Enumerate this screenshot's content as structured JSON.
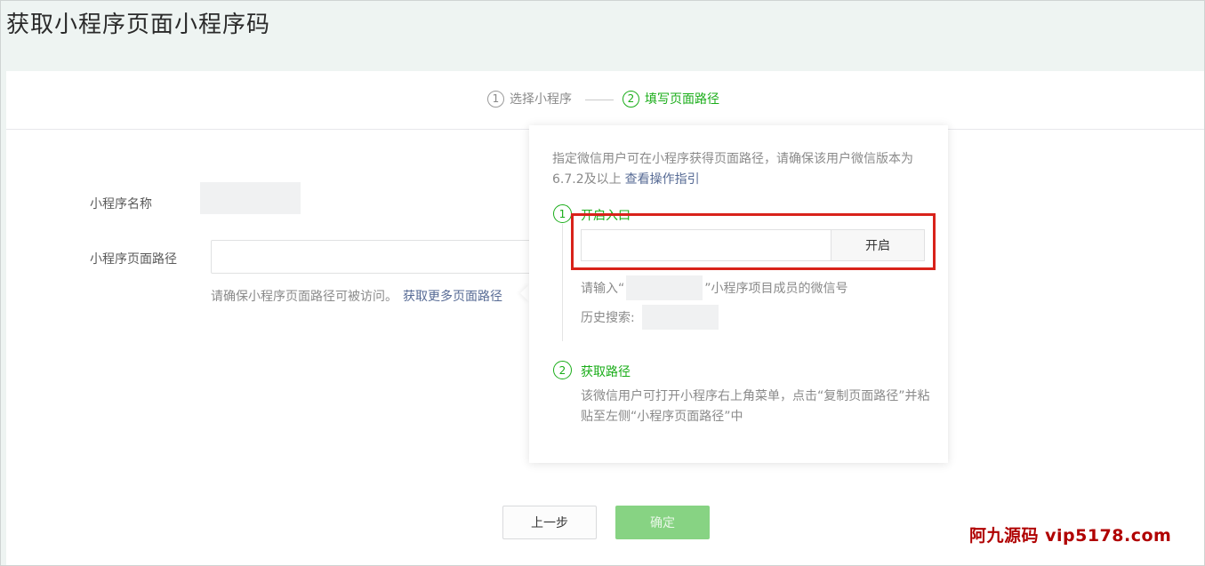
{
  "page": {
    "title": "获取小程序页面小程序码"
  },
  "steps": [
    {
      "num": "1",
      "label": "选择小程序"
    },
    {
      "num": "2",
      "label": "填写页面路径"
    }
  ],
  "form": {
    "name_label": "小程序名称",
    "path_label": "小程序页面路径",
    "path_value": "",
    "hint_text": "请确保小程序页面路径可被访问。",
    "hint_link": "获取更多页面路径"
  },
  "popover": {
    "intro_text": "指定微信用户可在小程序获得页面路径，请确保该用户微信版本为6.7.2及以上",
    "intro_link": "查看操作指引",
    "step1": {
      "num": "1",
      "title": "开启入口",
      "input_value": "",
      "button_label": "开启",
      "hint_prefix": "请输入“",
      "hint_suffix": "”小程序项目成员的微信号",
      "history_label": "历史搜索:"
    },
    "step2": {
      "num": "2",
      "title": "获取路径",
      "desc": "该微信用户可打开小程序右上角菜单，点击“复制页面路径”并粘贴至左侧“小程序页面路径”中"
    }
  },
  "buttons": {
    "prev": "上一步",
    "confirm": "确定"
  },
  "watermark": "阿九源码  vip5178.com",
  "colors": {
    "accent": "#1aad19",
    "link": "#576b95",
    "highlight": "#d8221a",
    "confirm_disabled": "#87d383"
  }
}
